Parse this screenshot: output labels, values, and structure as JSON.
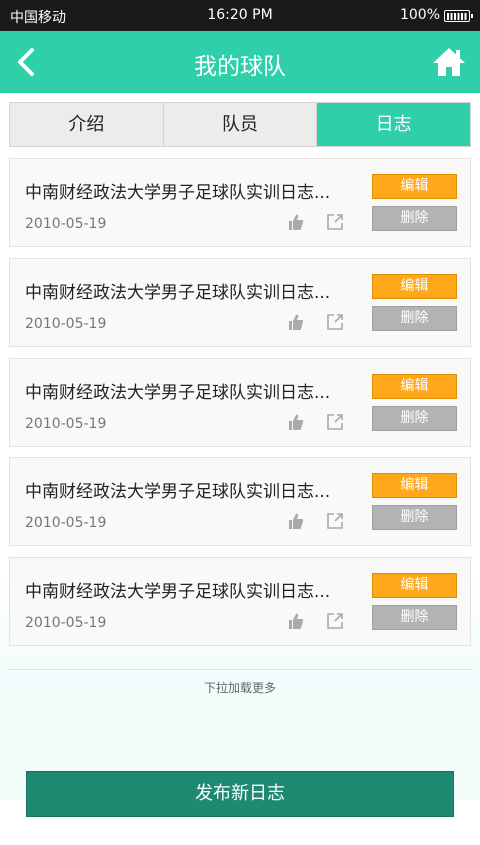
{
  "status_bar": {
    "carrier": "中国移动",
    "time": "16:20 PM",
    "battery": "100%"
  },
  "header": {
    "title": "我的球队",
    "back_icon": "chevron-left-icon",
    "home_icon": "home-icon"
  },
  "tabs": [
    {
      "label": "介绍",
      "active": false
    },
    {
      "label": "队员",
      "active": false
    },
    {
      "label": "日志",
      "active": true
    }
  ],
  "logs": [
    {
      "title": "中南财经政法大学男子足球队实训日志...",
      "date": "2010-05-19",
      "edit_label": "编辑",
      "delete_label": "删除"
    },
    {
      "title": "中南财经政法大学男子足球队实训日志...",
      "date": "2010-05-19",
      "edit_label": "编辑",
      "delete_label": "删除"
    },
    {
      "title": "中南财经政法大学男子足球队实训日志...",
      "date": "2010-05-19",
      "edit_label": "编辑",
      "delete_label": "删除"
    },
    {
      "title": "中南财经政法大学男子足球队实训日志...",
      "date": "2010-05-19",
      "edit_label": "编辑",
      "delete_label": "删除"
    },
    {
      "title": "中南财经政法大学男子足球队实训日志...",
      "date": "2010-05-19",
      "edit_label": "编辑",
      "delete_label": "删除"
    }
  ],
  "load_more": "下拉加载更多",
  "publish_button": "发布新日志",
  "colors": {
    "accent": "#2ecfa9",
    "edit": "#ffa81c",
    "delete": "#b3b3b3",
    "publish": "#1e8a72"
  }
}
